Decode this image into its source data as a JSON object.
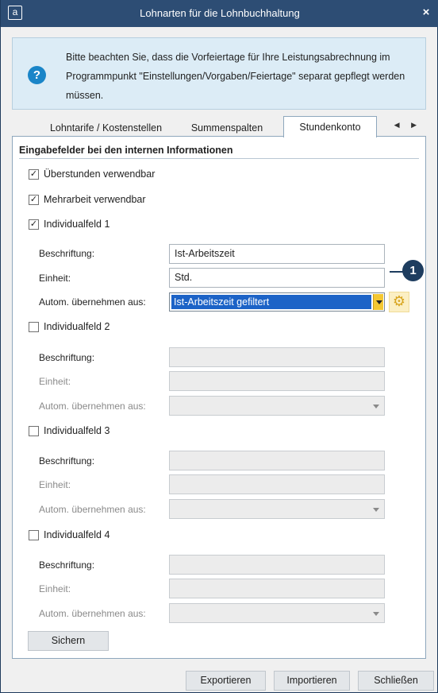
{
  "window": {
    "app_icon": "a",
    "title": "Lohnarten für die Lohnbuchhaltung",
    "close": "×"
  },
  "info": {
    "icon": "?",
    "text": "Bitte beachten Sie, dass die Vorfeiertage für Ihre Leistungsabrechnung im Programmpunkt \"Einstellungen/Vorgaben/Feiertage\" separat gepflegt werden müssen."
  },
  "tabs": [
    {
      "label": "Lohntarife / Kostenstellen",
      "active": false
    },
    {
      "label": "Summenspalten",
      "active": false
    },
    {
      "label": "Stundenkonto",
      "active": true
    }
  ],
  "tab_arrows": "◀ ▶",
  "section": {
    "title": "Eingabefelder bei den internen Informationen"
  },
  "checkboxes": {
    "ueberstunden": {
      "label": "Überstunden verwendbar",
      "checked": true
    },
    "mehrarbeit": {
      "label": "Mehrarbeit verwendbar",
      "checked": true
    }
  },
  "check_mark": "✓",
  "individualfelder": [
    {
      "label": "Individualfeld 1",
      "checked": true,
      "beschriftung_label": "Beschriftung:",
      "beschriftung_value": "Ist-Arbeitszeit",
      "einheit_label": "Einheit:",
      "einheit_value": "Std.",
      "autom_label": "Autom. übernehmen aus:",
      "autom_value": "Ist-Arbeitszeit gefiltert"
    },
    {
      "label": "Individualfeld 2",
      "checked": false,
      "beschriftung_label": "Beschriftung:",
      "beschriftung_value": "",
      "einheit_label": "Einheit:",
      "einheit_value": "",
      "autom_label": "Autom. übernehmen aus:",
      "autom_value": ""
    },
    {
      "label": "Individualfeld 3",
      "checked": false,
      "beschriftung_label": "Beschriftung:",
      "beschriftung_value": "",
      "einheit_label": "Einheit:",
      "einheit_value": "",
      "autom_label": "Autom. übernehmen aus:",
      "autom_value": ""
    },
    {
      "label": "Individualfeld 4",
      "checked": false,
      "beschriftung_label": "Beschriftung:",
      "beschriftung_value": "",
      "einheit_label": "Einheit:",
      "einheit_value": "",
      "autom_label": "Autom. übernehmen aus:",
      "autom_value": ""
    }
  ],
  "gear_icon": "⚙",
  "callout": {
    "number": "1"
  },
  "buttons": {
    "save": "Sichern",
    "export": "Exportieren",
    "import": "Importieren",
    "close": "Schließen"
  },
  "colors": {
    "titlebar": "#2d4d74",
    "accent_blue": "#1c63c7",
    "callout": "#1e3d5f",
    "info_bg": "#dcecf6",
    "gear_bg": "#fbefc4"
  }
}
